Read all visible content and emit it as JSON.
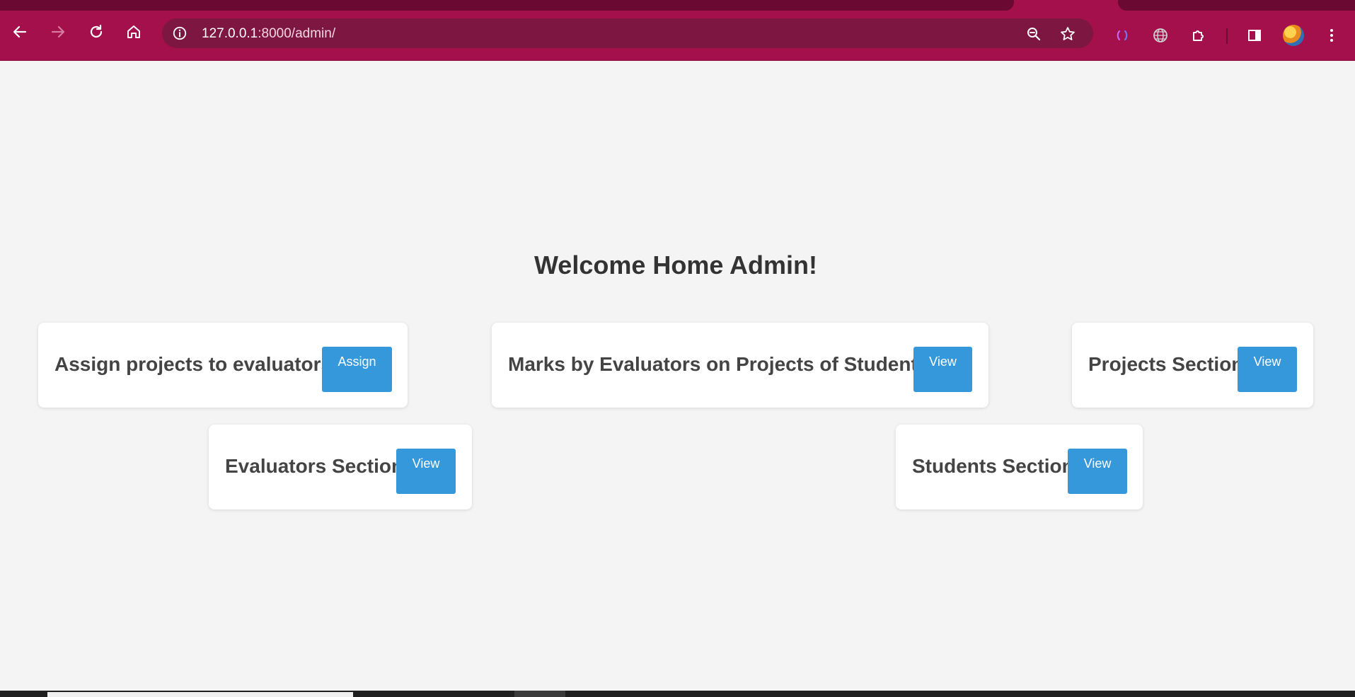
{
  "browser": {
    "url_host": "127.0.0.1",
    "url_rest": ":8000/admin/",
    "icons": {
      "back": "arrow-left-icon",
      "forward": "arrow-right-icon",
      "reload": "reload-icon",
      "home": "home-icon",
      "site_info": "info-icon",
      "zoom": "zoom-out-icon",
      "bookmark": "star-icon",
      "extension_1": "bracket-extension-icon",
      "extension_2": "globe-icon",
      "extensions": "puzzle-icon",
      "side_panel": "side-panel-icon",
      "profile": "avatar",
      "menu": "kebab-menu-icon"
    },
    "colors": {
      "frame": "#a3104c",
      "omnibox": "#7e1642"
    }
  },
  "page": {
    "heading": "Welcome Home Admin!",
    "cards": [
      {
        "title": "Assign projects to evaluators",
        "button": "Assign"
      },
      {
        "title": "Marks by Evaluators on Projects of Students",
        "button": "View"
      },
      {
        "title": "Projects Section",
        "button": "View"
      },
      {
        "title": "Evaluators Section",
        "button": "View"
      },
      {
        "title": "Students Section",
        "button": "View"
      }
    ],
    "colors": {
      "background": "#f4f4f4",
      "button": "#3498db",
      "text": "#333333"
    }
  }
}
